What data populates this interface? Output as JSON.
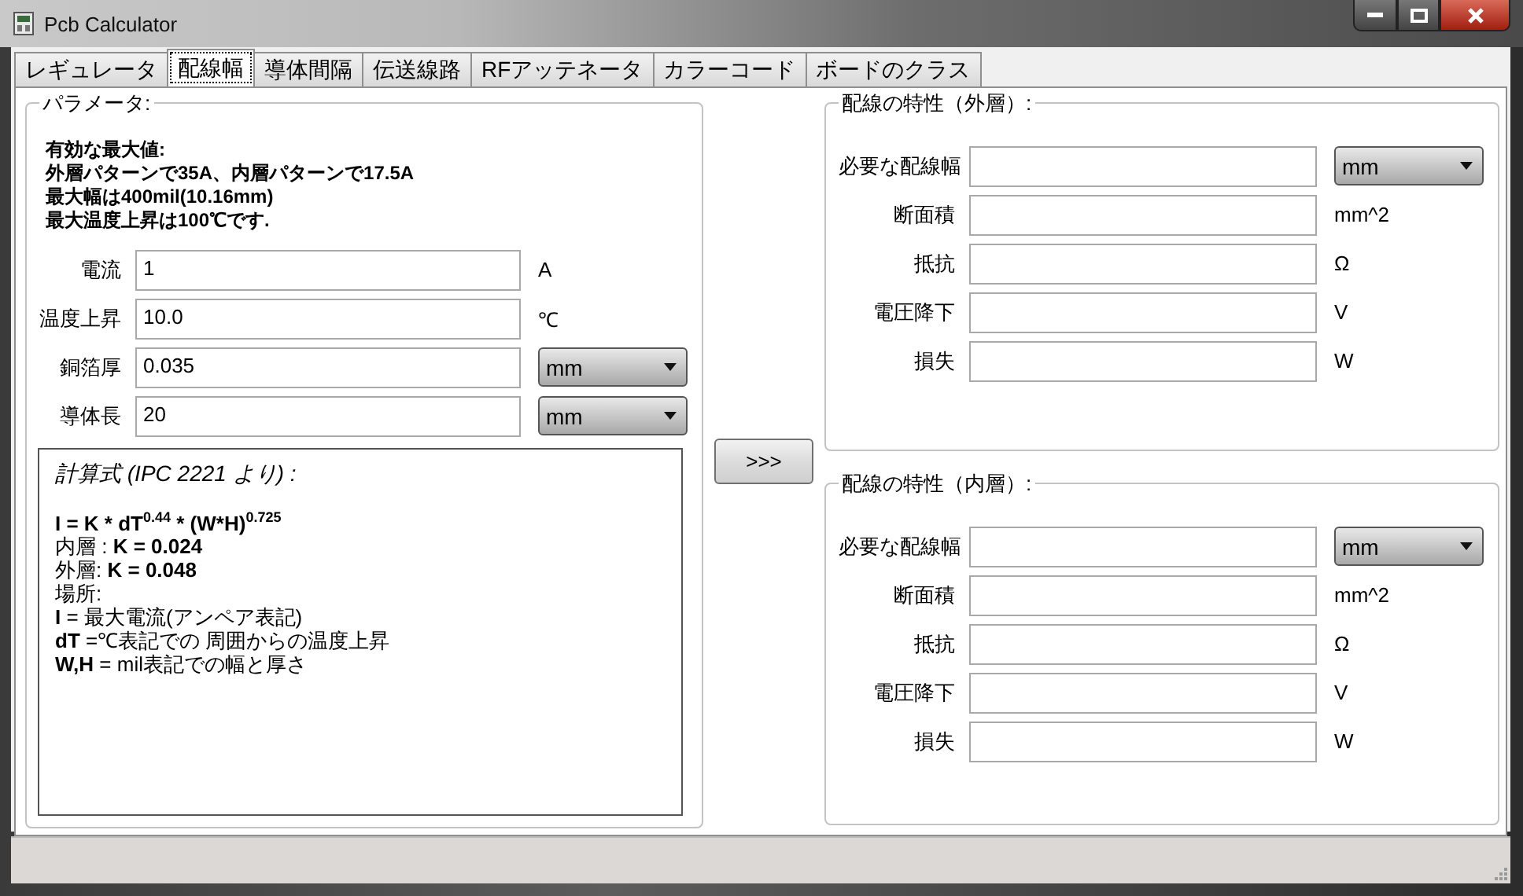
{
  "window": {
    "title": "Pcb Calculator"
  },
  "tabs": [
    {
      "label": "レギュレータ",
      "selected": false
    },
    {
      "label": "配線幅",
      "selected": true
    },
    {
      "label": "導体間隔",
      "selected": false
    },
    {
      "label": "伝送線路",
      "selected": false
    },
    {
      "label": "RFアッテネータ",
      "selected": false
    },
    {
      "label": "カラーコード",
      "selected": false
    },
    {
      "label": "ボードのクラス",
      "selected": false
    }
  ],
  "parameters": {
    "title": "パラメータ:",
    "notes": [
      "有効な最大値:",
      "外層パターンで35A、内層パターンで17.5A",
      "最大幅は400mil(10.16mm)",
      "最大温度上昇は100℃です."
    ],
    "rows": [
      {
        "label": "電流",
        "value": "1",
        "unit": {
          "kind": "text",
          "text": "A"
        }
      },
      {
        "label": "温度上昇",
        "value": "10.0",
        "unit": {
          "kind": "text",
          "text": "℃"
        }
      },
      {
        "label": "銅箔厚",
        "value": "0.035",
        "unit": {
          "kind": "dropdown",
          "text": "mm"
        }
      },
      {
        "label": "導体長",
        "value": "20",
        "unit": {
          "kind": "dropdown",
          "text": "mm"
        }
      }
    ],
    "formula": [
      {
        "kind": "heading",
        "text": "計算式 (IPC 2221 より) :"
      },
      {
        "kind": "equation",
        "text": "I = K * dT$^{0.44}$ * (W*H)$^{0.725}$"
      },
      {
        "kind": "line",
        "text": "内層 : **K = 0.024**"
      },
      {
        "kind": "line",
        "text": "外層: **K = 0.048**"
      },
      {
        "kind": "line",
        "text": "場所:"
      },
      {
        "kind": "line",
        "text": "**I** = 最大電流(アンペア表記)"
      },
      {
        "kind": "line",
        "text": "**dT** =℃表記での 周囲からの温度上昇"
      },
      {
        "kind": "line",
        "text": "**W,H** = mil表記での幅と厚さ"
      }
    ]
  },
  "calculate_button": ">>>",
  "results": [
    {
      "title": "配線の特性（外層）:",
      "rows": [
        {
          "label": "必要な配線幅",
          "unit": {
            "kind": "dropdown",
            "text": "mm"
          }
        },
        {
          "label": "断面積",
          "unit": {
            "kind": "text",
            "text": "mm^2"
          }
        },
        {
          "label": "抵抗",
          "unit": {
            "kind": "text",
            "text": "Ω"
          }
        },
        {
          "label": "電圧降下",
          "unit": {
            "kind": "text",
            "text": "V"
          }
        },
        {
          "label": "損失",
          "unit": {
            "kind": "text",
            "text": "W"
          }
        }
      ]
    },
    {
      "title": "配線の特性（内層）:",
      "rows": [
        {
          "label": "必要な配線幅",
          "unit": {
            "kind": "dropdown",
            "text": "mm"
          }
        },
        {
          "label": "断面積",
          "unit": {
            "kind": "text",
            "text": "mm^2"
          }
        },
        {
          "label": "抵抗",
          "unit": {
            "kind": "text",
            "text": "Ω"
          }
        },
        {
          "label": "電圧降下",
          "unit": {
            "kind": "text",
            "text": "V"
          }
        },
        {
          "label": "損失",
          "unit": {
            "kind": "text",
            "text": "W"
          }
        }
      ]
    }
  ]
}
